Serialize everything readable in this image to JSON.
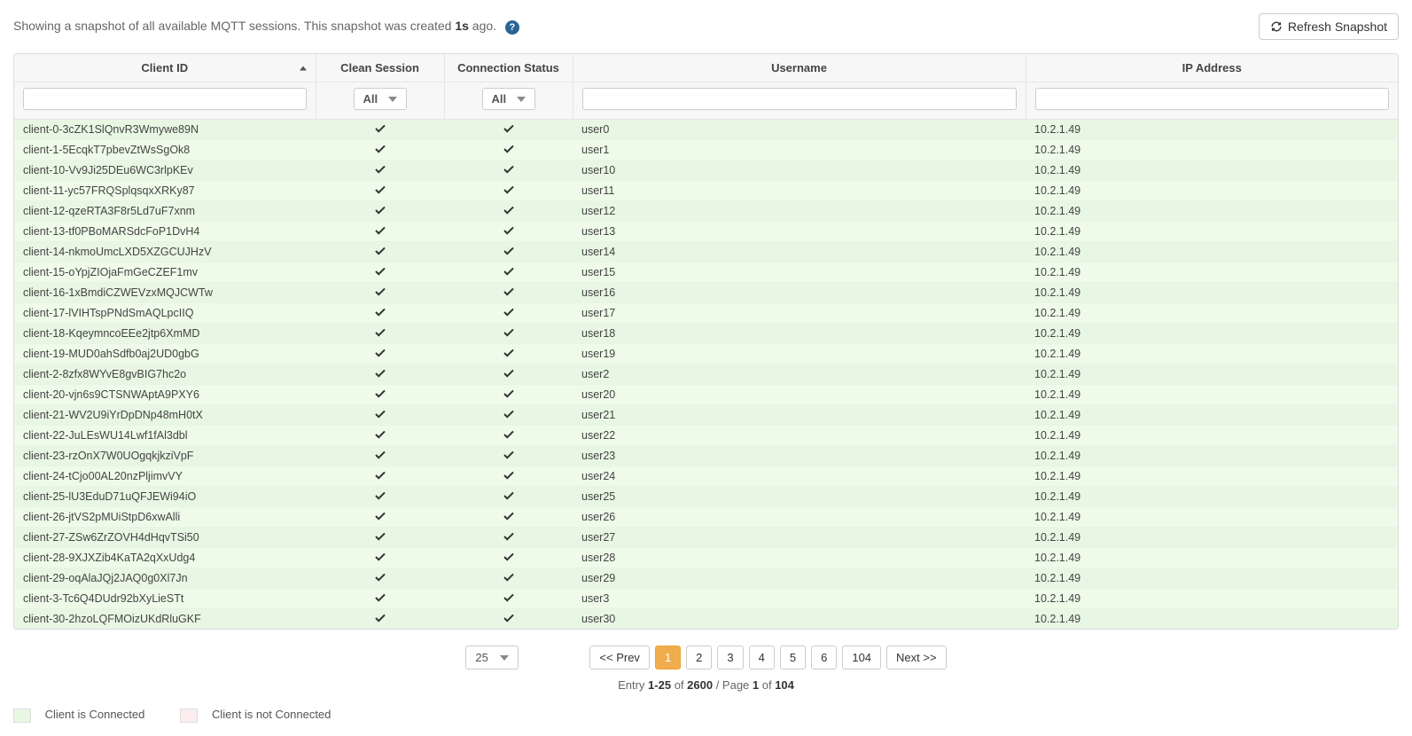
{
  "header": {
    "text_prefix": "Showing a snapshot of all available MQTT sessions. ",
    "time_text_a": "This snapshot was created ",
    "time_value": "1s",
    "time_text_b": " ago."
  },
  "refresh_btn": "Refresh Snapshot",
  "columns": {
    "client_id": "Client ID",
    "clean_session": "Clean Session",
    "connection_status": "Connection Status",
    "username": "Username",
    "ip_address": "IP Address"
  },
  "filters": {
    "clean_session_all": "All",
    "connection_status_all": "All"
  },
  "rows": [
    {
      "client_id": "client-0-3cZK1SlQnvR3Wmywe89N",
      "clean": true,
      "connected": true,
      "username": "user0",
      "ip": "10.2.1.49"
    },
    {
      "client_id": "client-1-5EcqkT7pbevZtWsSgOk8",
      "clean": true,
      "connected": true,
      "username": "user1",
      "ip": "10.2.1.49"
    },
    {
      "client_id": "client-10-Vv9Ji25DEu6WC3rlpKEv",
      "clean": true,
      "connected": true,
      "username": "user10",
      "ip": "10.2.1.49"
    },
    {
      "client_id": "client-11-yc57FRQSplqsqxXRKy87",
      "clean": true,
      "connected": true,
      "username": "user11",
      "ip": "10.2.1.49"
    },
    {
      "client_id": "client-12-qzeRTA3F8r5Ld7uF7xnm",
      "clean": true,
      "connected": true,
      "username": "user12",
      "ip": "10.2.1.49"
    },
    {
      "client_id": "client-13-tf0PBoMARSdcFoP1DvH4",
      "clean": true,
      "connected": true,
      "username": "user13",
      "ip": "10.2.1.49"
    },
    {
      "client_id": "client-14-nkmoUmcLXD5XZGCUJHzV",
      "clean": true,
      "connected": true,
      "username": "user14",
      "ip": "10.2.1.49"
    },
    {
      "client_id": "client-15-oYpjZIOjaFmGeCZEF1mv",
      "clean": true,
      "connected": true,
      "username": "user15",
      "ip": "10.2.1.49"
    },
    {
      "client_id": "client-16-1xBmdiCZWEVzxMQJCWTw",
      "clean": true,
      "connected": true,
      "username": "user16",
      "ip": "10.2.1.49"
    },
    {
      "client_id": "client-17-lVIHTspPNdSmAQLpcIIQ",
      "clean": true,
      "connected": true,
      "username": "user17",
      "ip": "10.2.1.49"
    },
    {
      "client_id": "client-18-KqeymncoEEe2jtp6XmMD",
      "clean": true,
      "connected": true,
      "username": "user18",
      "ip": "10.2.1.49"
    },
    {
      "client_id": "client-19-MUD0ahSdfb0aj2UD0gbG",
      "clean": true,
      "connected": true,
      "username": "user19",
      "ip": "10.2.1.49"
    },
    {
      "client_id": "client-2-8zfx8WYvE8gvBIG7hc2o",
      "clean": true,
      "connected": true,
      "username": "user2",
      "ip": "10.2.1.49"
    },
    {
      "client_id": "client-20-vjn6s9CTSNWAptA9PXY6",
      "clean": true,
      "connected": true,
      "username": "user20",
      "ip": "10.2.1.49"
    },
    {
      "client_id": "client-21-WV2U9iYrDpDNp48mH0tX",
      "clean": true,
      "connected": true,
      "username": "user21",
      "ip": "10.2.1.49"
    },
    {
      "client_id": "client-22-JuLEsWU14Lwf1fAl3dbl",
      "clean": true,
      "connected": true,
      "username": "user22",
      "ip": "10.2.1.49"
    },
    {
      "client_id": "client-23-rzOnX7W0UOgqkjkziVpF",
      "clean": true,
      "connected": true,
      "username": "user23",
      "ip": "10.2.1.49"
    },
    {
      "client_id": "client-24-tCjo00AL20nzPljimvVY",
      "clean": true,
      "connected": true,
      "username": "user24",
      "ip": "10.2.1.49"
    },
    {
      "client_id": "client-25-lU3EduD71uQFJEWi94iO",
      "clean": true,
      "connected": true,
      "username": "user25",
      "ip": "10.2.1.49"
    },
    {
      "client_id": "client-26-jtVS2pMUiStpD6xwAlli",
      "clean": true,
      "connected": true,
      "username": "user26",
      "ip": "10.2.1.49"
    },
    {
      "client_id": "client-27-ZSw6ZrZOVH4dHqvTSi50",
      "clean": true,
      "connected": true,
      "username": "user27",
      "ip": "10.2.1.49"
    },
    {
      "client_id": "client-28-9XJXZib4KaTA2qXxUdg4",
      "clean": true,
      "connected": true,
      "username": "user28",
      "ip": "10.2.1.49"
    },
    {
      "client_id": "client-29-oqAlaJQj2JAQ0g0Xl7Jn",
      "clean": true,
      "connected": true,
      "username": "user29",
      "ip": "10.2.1.49"
    },
    {
      "client_id": "client-3-Tc6Q4DUdr92bXyLieSTt",
      "clean": true,
      "connected": true,
      "username": "user3",
      "ip": "10.2.1.49"
    },
    {
      "client_id": "client-30-2hzoLQFMOizUKdRluGKF",
      "clean": true,
      "connected": true,
      "username": "user30",
      "ip": "10.2.1.49"
    }
  ],
  "page_size": "25",
  "pager": {
    "prev": "<< Prev",
    "pages": [
      "1",
      "2",
      "3",
      "4",
      "5",
      "6",
      "104"
    ],
    "active": "1",
    "next": "Next >>"
  },
  "summary": {
    "label_entry": "Entry ",
    "range": "1-25",
    "label_of1": " of ",
    "total": "2600",
    "label_page": " / Page ",
    "page": "1",
    "label_of2": " of ",
    "pages": "104"
  },
  "legend": {
    "connected": "Client is Connected",
    "disconnected": "Client is not Connected"
  }
}
